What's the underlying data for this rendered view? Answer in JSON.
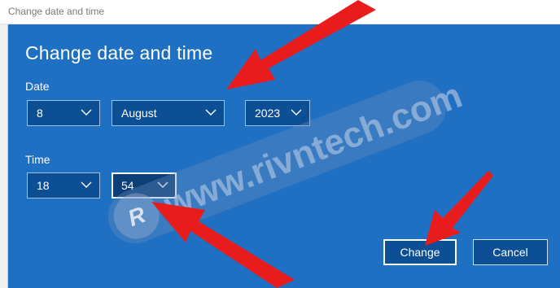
{
  "window": {
    "title": "Change date and time"
  },
  "dialog": {
    "title": "Change date and time",
    "date_label": "Date",
    "time_label": "Time",
    "day": "8",
    "month": "August",
    "year": "2023",
    "hour": "18",
    "minute": "54",
    "change_button": "Change",
    "cancel_button": "Cancel"
  },
  "watermark": {
    "text": "www.rivntech.com",
    "logo": "R"
  },
  "colors": {
    "dialog_bg": "#1f6fc2",
    "field_bg": "#0d4f95",
    "arrow": "#e81c1c"
  },
  "icons": {
    "dropdown": "chevron-down-icon"
  }
}
